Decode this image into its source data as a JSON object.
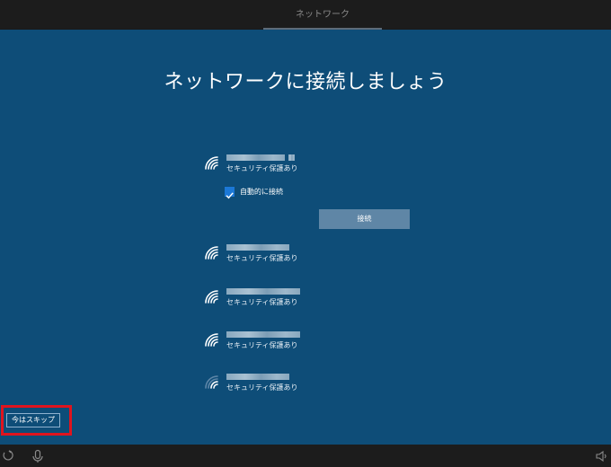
{
  "topbar": {
    "title": "ネットワーク"
  },
  "main": {
    "heading": "ネットワークに接続しましょう",
    "networks": [
      {
        "ssid": "",
        "security": "セキュリティ保護あり",
        "signal": 4
      },
      {
        "ssid": "",
        "security": "セキュリティ保護あり",
        "signal": 4
      },
      {
        "ssid": "",
        "security": "セキュリティ保護あり",
        "signal": 4
      },
      {
        "ssid": "",
        "security": "セキュリティ保護あり",
        "signal": 4
      },
      {
        "ssid": "",
        "security": "セキュリティ保護あり",
        "signal": 2
      }
    ],
    "auto_connect": {
      "label": "自動的に接続",
      "checked": true
    },
    "connect_button": "接続",
    "skip_button": "今はスキップ"
  },
  "colors": {
    "background": "#0e4d78",
    "checkbox": "#1c78d6",
    "connect_button": "#5f86a6",
    "highlight": "#e0141e"
  },
  "icons": {
    "network": "wifi-icon",
    "checkbox": "check-icon",
    "bottom_left": "ease-of-access-icon",
    "bottom_mic": "microphone-icon",
    "bottom_right": "volume-icon"
  }
}
